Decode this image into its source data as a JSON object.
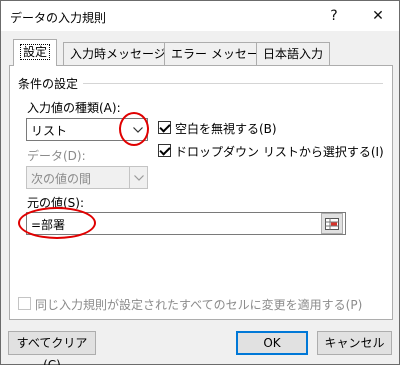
{
  "window": {
    "title": "データの入力規則",
    "help_glyph": "?",
    "close_glyph": "✕"
  },
  "tabs": [
    {
      "label": "設定",
      "active": true
    },
    {
      "label": "入力時メッセージ",
      "active": false
    },
    {
      "label": "エラー メッセージ",
      "active": false
    },
    {
      "label": "日本語入力",
      "active": false
    }
  ],
  "settings": {
    "group_label": "条件の設定",
    "allow_label": "入力値の種類(A):",
    "allow_value": "リスト",
    "ignore_blank_label": "空白を無視する(B)",
    "ignore_blank_checked": true,
    "in_cell_dropdown_label": "ドロップダウン リストから選択する(I)",
    "in_cell_dropdown_checked": true,
    "data_label": "データ(D):",
    "data_value": "次の値の間",
    "source_label": "元の値(S):",
    "source_value": "=部署",
    "apply_all_label": "同じ入力規則が設定されたすべてのセルに変更を適用する(P)",
    "apply_all_checked": false
  },
  "buttons": {
    "clear_all": "すべてクリア(C)",
    "ok": "OK",
    "cancel": "キャンセル"
  },
  "colors": {
    "annotation": "#e00000",
    "default_button_border": "#0078d7"
  }
}
